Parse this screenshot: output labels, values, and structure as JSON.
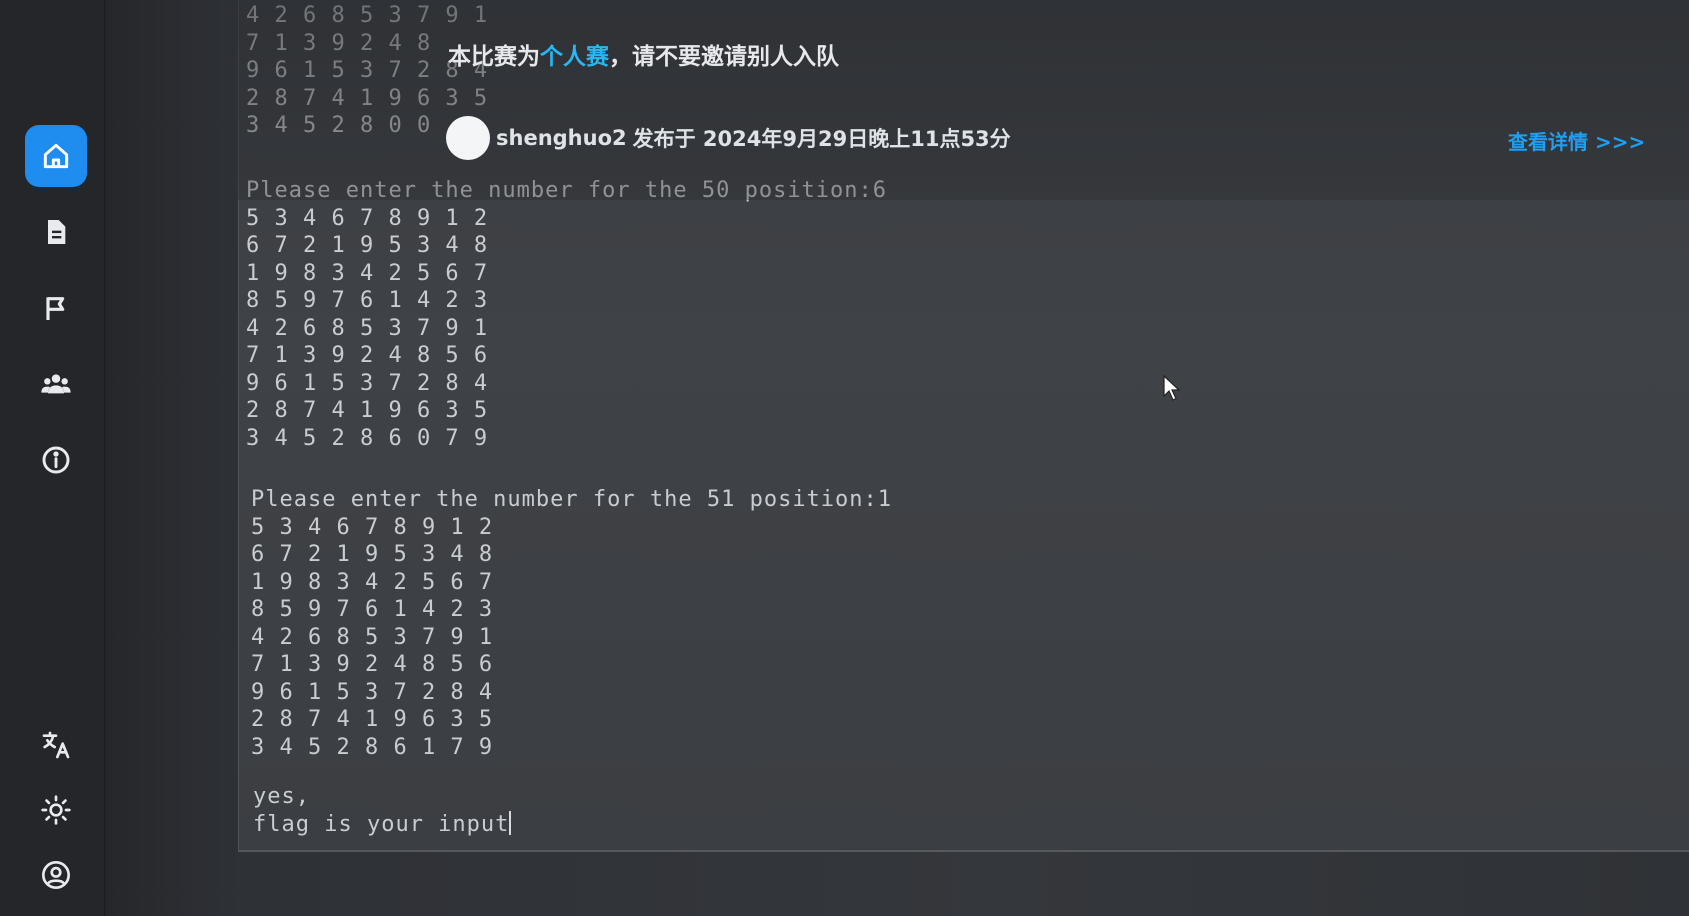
{
  "sidebar": {
    "items": [
      {
        "name": "home",
        "icon": "home-icon",
        "active": true
      },
      {
        "name": "documents",
        "icon": "document-icon",
        "active": false
      },
      {
        "name": "challenges",
        "icon": "flag-icon",
        "active": false
      },
      {
        "name": "teams",
        "icon": "users-icon",
        "active": false
      },
      {
        "name": "about",
        "icon": "info-icon",
        "active": false
      }
    ],
    "bottom_items": [
      {
        "name": "language",
        "icon": "translate-icon"
      },
      {
        "name": "theme",
        "icon": "sun-icon"
      },
      {
        "name": "profile",
        "icon": "user-circle-icon"
      }
    ],
    "accent": "#1f8df0"
  },
  "announcement": {
    "prefix": "本比赛为",
    "highlight": "个人赛",
    "suffix": "，请不要邀请别人入队",
    "author": "shenghuo2",
    "posted_text": "发布于 2024年9月29日晚上11点53分",
    "detail_link": "查看详情 >>>",
    "link_color": "#1f9ff0"
  },
  "terminal": {
    "top_block": [
      "4 2 6 8 5 3 7 9 1",
      "7 1 3 9 2 4 8",
      "9 6 1 5 3 7 2 8 4",
      "2 8 7 4 1 9 6 3 5",
      "3 4 5 2 8 0 0"
    ],
    "prompt1": "Please enter the number for the 50 position:6",
    "grid1": [
      "5 3 4 6 7 8 9 1 2",
      "6 7 2 1 9 5 3 4 8",
      "1 9 8 3 4 2 5 6 7",
      "8 5 9 7 6 1 4 2 3",
      "4 2 6 8 5 3 7 9 1",
      "7 1 3 9 2 4 8 5 6",
      "9 6 1 5 3 7 2 8 4",
      "2 8 7 4 1 9 6 3 5",
      "3 4 5 2 8 6 0 7 9"
    ],
    "prompt2": "Please enter the number for the 51 position:1",
    "grid2": [
      "5 3 4 6 7 8 9 1 2",
      "6 7 2 1 9 5 3 4 8",
      "1 9 8 3 4 2 5 6 7",
      "8 5 9 7 6 1 4 2 3",
      "4 2 6 8 5 3 7 9 1",
      "7 1 3 9 2 4 8 5 6",
      "9 6 1 5 3 7 2 8 4",
      "2 8 7 4 1 9 6 3 5",
      "3 4 5 2 8 6 1 7 9"
    ],
    "result_line1": "yes,",
    "result_line2": "flag is your input"
  }
}
